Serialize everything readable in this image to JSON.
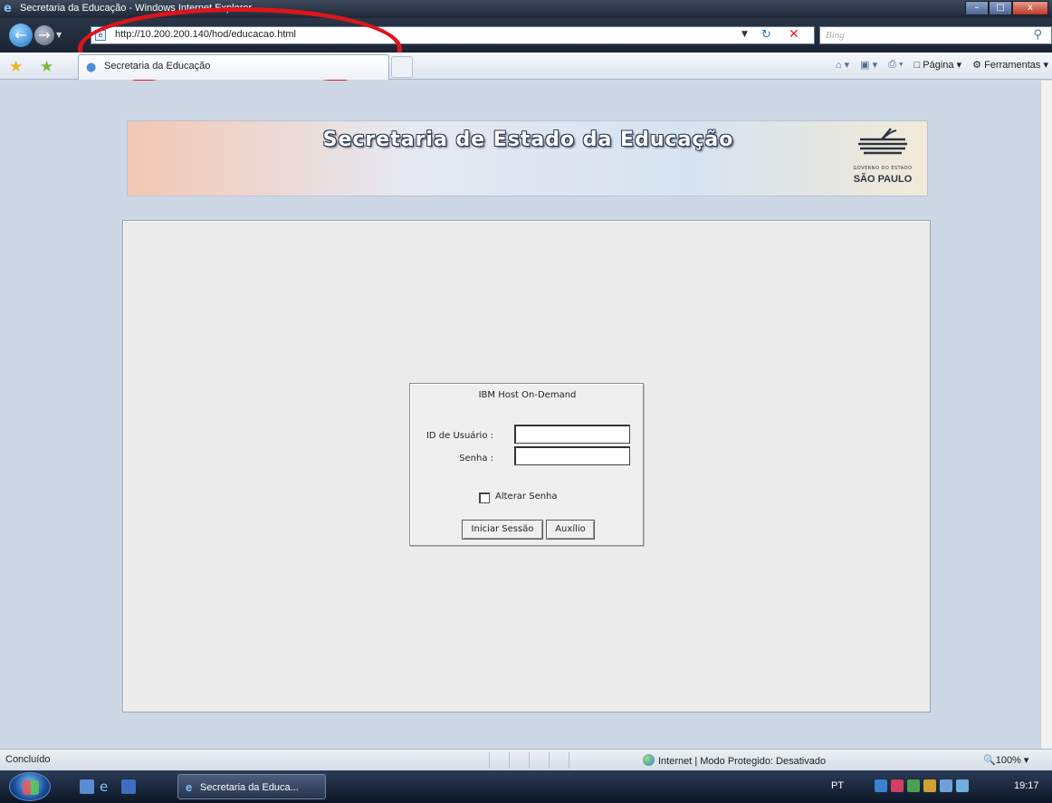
{
  "window": {
    "title": "Secretaria da Educação - Windows Internet Explorer",
    "minimize_glyph": "–",
    "maximize_glyph": "□",
    "close_glyph": "x"
  },
  "address_bar": {
    "url": "http://10.200.200.140/hod/educacao.html",
    "search_placeholder": "Bing"
  },
  "tabs": [
    {
      "label": "Secretaria da Educação"
    }
  ],
  "command_bar": {
    "page_label": "Página",
    "tools_label": "Ferramentas"
  },
  "banner": {
    "title": "Secretaria de Estado da Educação",
    "logo_text": "SÃO PAULO",
    "logo_subtext": "GOVERNO DO ESTADO"
  },
  "login": {
    "title": "IBM Host On-Demand",
    "user_label": "ID de Usuário :",
    "user_value": "",
    "password_label": "Senha :",
    "password_value": "",
    "change_password_label": "Alterar Senha",
    "change_password_checked": false,
    "start_button": "Iniciar Sessão",
    "help_button": "Auxílio"
  },
  "status_bar": {
    "status": "Concluído",
    "zone": "Internet | Modo Protegido: Desativado",
    "zoom": "100%"
  },
  "taskbar": {
    "window_button": "Secretaria da Educa...",
    "language": "PT",
    "clock": "19:17"
  },
  "colors": {
    "highlight_oval": "#e0141b",
    "page_background": "#cdd7e6",
    "applet_background": "#ececec"
  }
}
